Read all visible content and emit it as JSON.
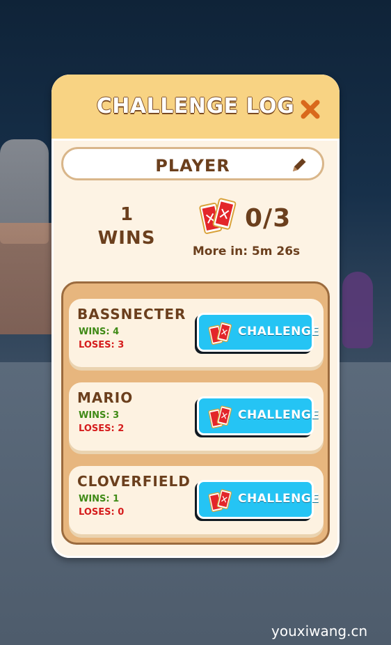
{
  "modal": {
    "title": "CHALLENGE LOG",
    "player_name": "PLAYER",
    "wins_count": "1",
    "wins_label": "WINS",
    "tickets": "0/3",
    "refill_text": "More in: 5m 26s"
  },
  "opponents": [
    {
      "name": "BASSNECTER",
      "wins": "WINS: 4",
      "loses": "LOSES: 3",
      "button": "CHALLENGE"
    },
    {
      "name": "MARIO",
      "wins": "WINS: 3",
      "loses": "LOSES: 2",
      "button": "CHALLENGE"
    },
    {
      "name": "CLOVERFIELD",
      "wins": "WINS: 1",
      "loses": "LOSES: 0",
      "button": "CHALLENGE"
    }
  ],
  "watermark": "youxiwang.cn",
  "colors": {
    "header": "#f8d383",
    "button": "#25c4f4",
    "wins": "#3f8a16",
    "loses": "#d51c1c",
    "text_brown": "#6b3f1d",
    "close": "#d9691c"
  },
  "icons": [
    "close-icon",
    "pencil-icon",
    "ticket-icon"
  ]
}
